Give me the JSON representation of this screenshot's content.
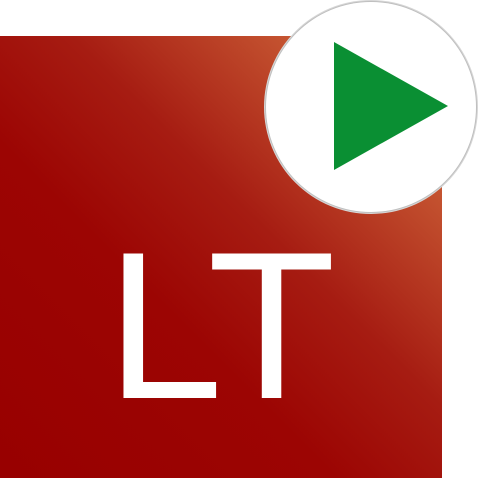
{
  "logo": {
    "text": "LT",
    "text_color": "#ffffff",
    "background_colors": [
      "#980000",
      "#a61c12",
      "#c45330",
      "#e0a282"
    ]
  },
  "badge": {
    "icon": "play-icon",
    "background_color": "#ffffff",
    "icon_color": "#0a8f33"
  }
}
